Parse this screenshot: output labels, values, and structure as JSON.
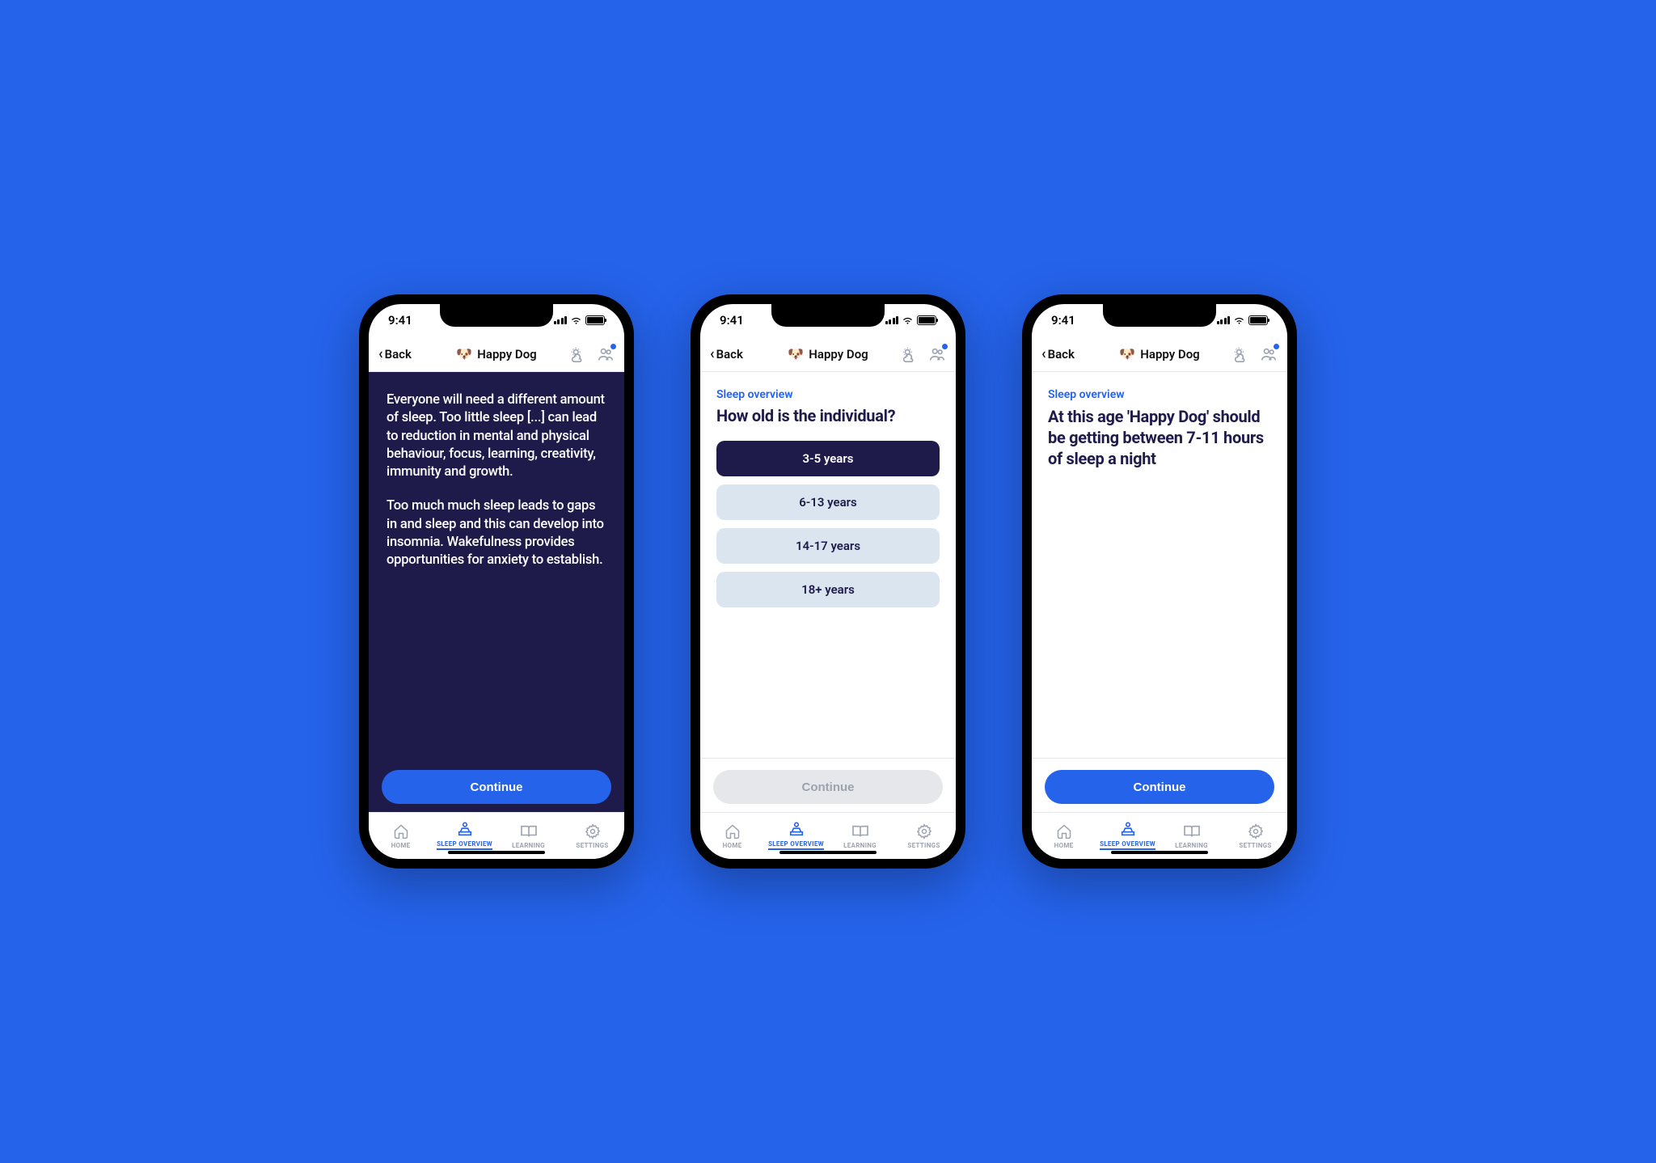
{
  "status": {
    "time": "9:41"
  },
  "header": {
    "back": "Back",
    "title": "Happy Dog"
  },
  "tabs": {
    "home": "HOME",
    "sleep": "SLEEP OVERVIEW",
    "learning": "LEARNING",
    "settings": "SETTINGS"
  },
  "screen1": {
    "para1": "Everyone will need a different amount of sleep. Too little sleep [...] can lead to reduction in mental and physical behaviour, focus, learning, creativity, immunity and growth.",
    "para2": "Too much much sleep leads to gaps in and sleep and this can develop into insomnia. Wakefulness provides opportunities for anxiety to establish.",
    "continue": "Continue"
  },
  "screen2": {
    "section": "Sleep overview",
    "question": "How old is the individual?",
    "options": [
      "3-5 years",
      "6-13 years",
      "14-17 years",
      "18+ years"
    ],
    "selectedIndex": 0,
    "continue": "Continue"
  },
  "screen3": {
    "section": "Sleep overview",
    "result": "At this age 'Happy Dog' should be getting between 7-11 hours of sleep a night",
    "continue": "Continue"
  }
}
